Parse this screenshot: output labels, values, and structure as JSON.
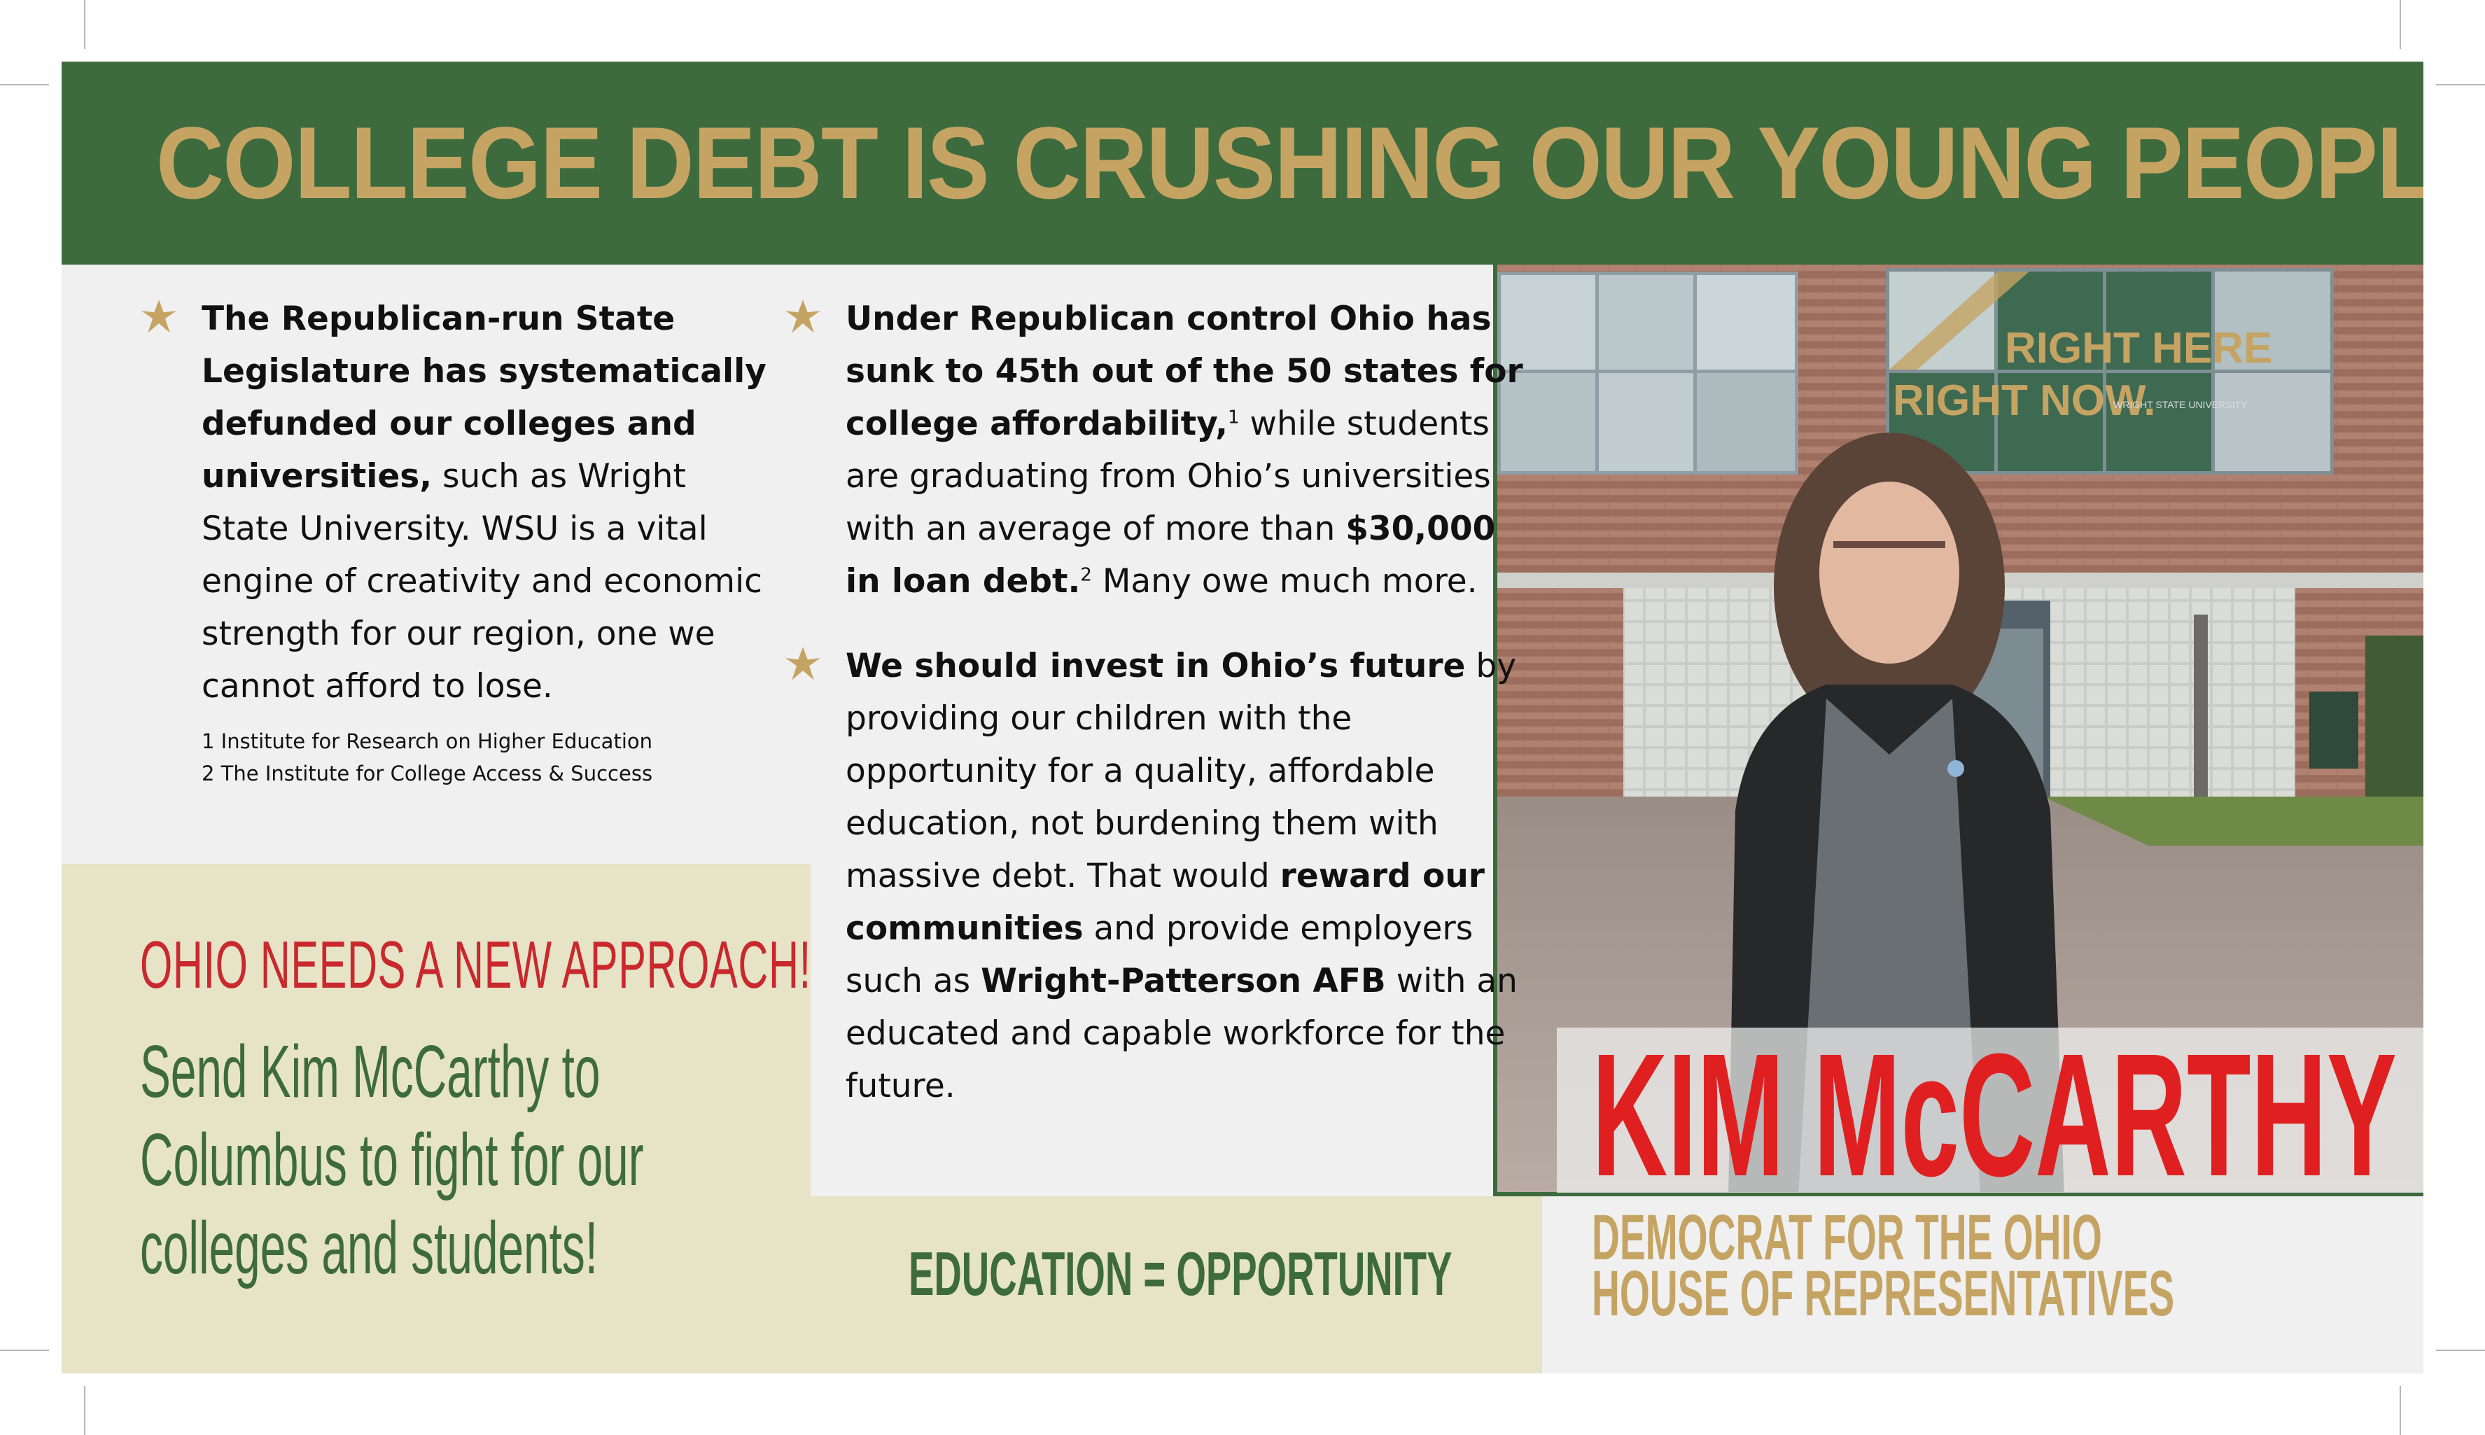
{
  "header": {
    "headline": "COLLEGE DEBT IS CRUSHING OUR YOUNG PEOPLE"
  },
  "left_column": {
    "bullet1_bold": "The Republican-run State Legislature has systematically defunded our colleges and universities,",
    "bullet1_text": " such as Wright State University. WSU is a vital engine of creativity and economic strength for our region, one we cannot afford to lose.",
    "sources": [
      "1 Institute for Research on Higher Education",
      "2 The Institute for College Access & Success"
    ]
  },
  "middle_column": {
    "bullet2_bold1": "Under Republican control Ohio has sunk to 45th out of the 50 states for college affordability,",
    "bullet2_sup1": "1",
    "bullet2_text1": " while students are graduating from Ohio’s universities with an average of more than ",
    "bullet2_bold2": "$30,000 in loan debt.",
    "bullet2_sup2": "2",
    "bullet2_text2": " Many owe much more.",
    "bullet3_bold1": "We should invest in Ohio’s future",
    "bullet3_text1": " by providing our children with the opportunity for a quality, affordable education, not burdening them with massive debt. That would ",
    "bullet3_bold2": "reward our communities",
    "bullet3_text2": " and provide employers such as ",
    "bullet3_bold3": "Wright-Patterson AFB",
    "bullet3_text3": " with an educated and capable workforce for the future."
  },
  "approach": {
    "title": "OHIO NEEDS A NEW APPROACH!",
    "body": "Send Kim McCarthy to Columbus to fight for our colleges and students!"
  },
  "tagline": "EDUCATION = OPPORTUNITY",
  "photo": {
    "window_sign_line1": "RIGHT HERE",
    "window_sign_line2": "RIGHT NOW.",
    "window_sign_small": "WRIGHT STATE UNIVERSITY"
  },
  "candidate": {
    "name": "KIM McCARTHY",
    "office_line1": "DEMOCRAT FOR THE OHIO",
    "office_line2": "HOUSE OF REPRESENTATIVES"
  },
  "icons": {
    "bullet": "star-icon"
  },
  "colors": {
    "green": "#3d6b3e",
    "gold": "#c5a463",
    "red": "#e02020",
    "cream": "#e6e3c6",
    "light_gray": "#f0f0f0"
  }
}
